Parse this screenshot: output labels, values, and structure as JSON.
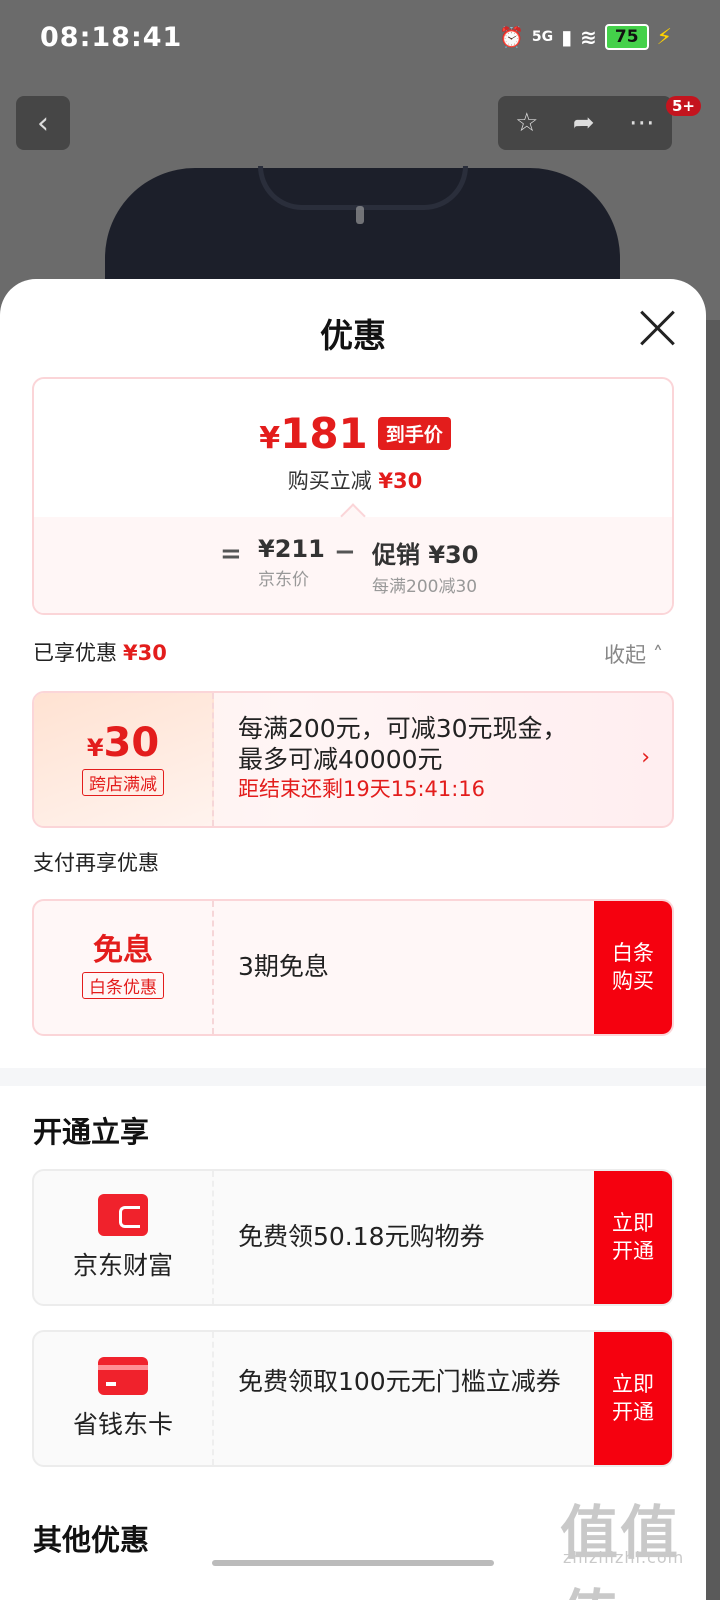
{
  "status_bar": {
    "time": "08:18:41",
    "network": "5G",
    "battery": "75"
  },
  "nav": {
    "back_icon": "chevron-left-icon",
    "badge": "5+"
  },
  "sheet": {
    "title": "优惠",
    "price": {
      "yen": "¥",
      "amount": "181",
      "tag": "到手价",
      "sub_label": "购买立减",
      "sub_value": "¥30"
    },
    "formula": {
      "eq": "=",
      "base_value": "¥211",
      "base_label": "京东价",
      "minus": "−",
      "promo_value": "促销 ¥30",
      "promo_label": "每满200减30"
    },
    "enjoyed": {
      "label": "已享优惠",
      "value": "¥30",
      "collapse": "收起"
    },
    "coupon1": {
      "yen": "¥",
      "amount": "30",
      "tag": "跨店满减",
      "line1": "每满200元，可减30元现金，",
      "line2": "最多可减40000元",
      "countdown": "距结束还剩19天15:41:16"
    },
    "pay_section": "支付再享优惠",
    "coupon2": {
      "title": "免息",
      "tag": "白条优惠",
      "text": "3期免息",
      "button": "白条购买"
    },
    "open_section": "开通立享",
    "service1": {
      "name": "京东财富",
      "text": "免费领50.18元购物券",
      "button": "立即开通"
    },
    "service2": {
      "name": "省钱东卡",
      "text": "免费领取100元无门槛立减券",
      "button": "立即开通"
    },
    "other_section": "其他优惠"
  },
  "watermark": {
    "main": "值值值",
    "sub": "zhizhizhi.com"
  }
}
